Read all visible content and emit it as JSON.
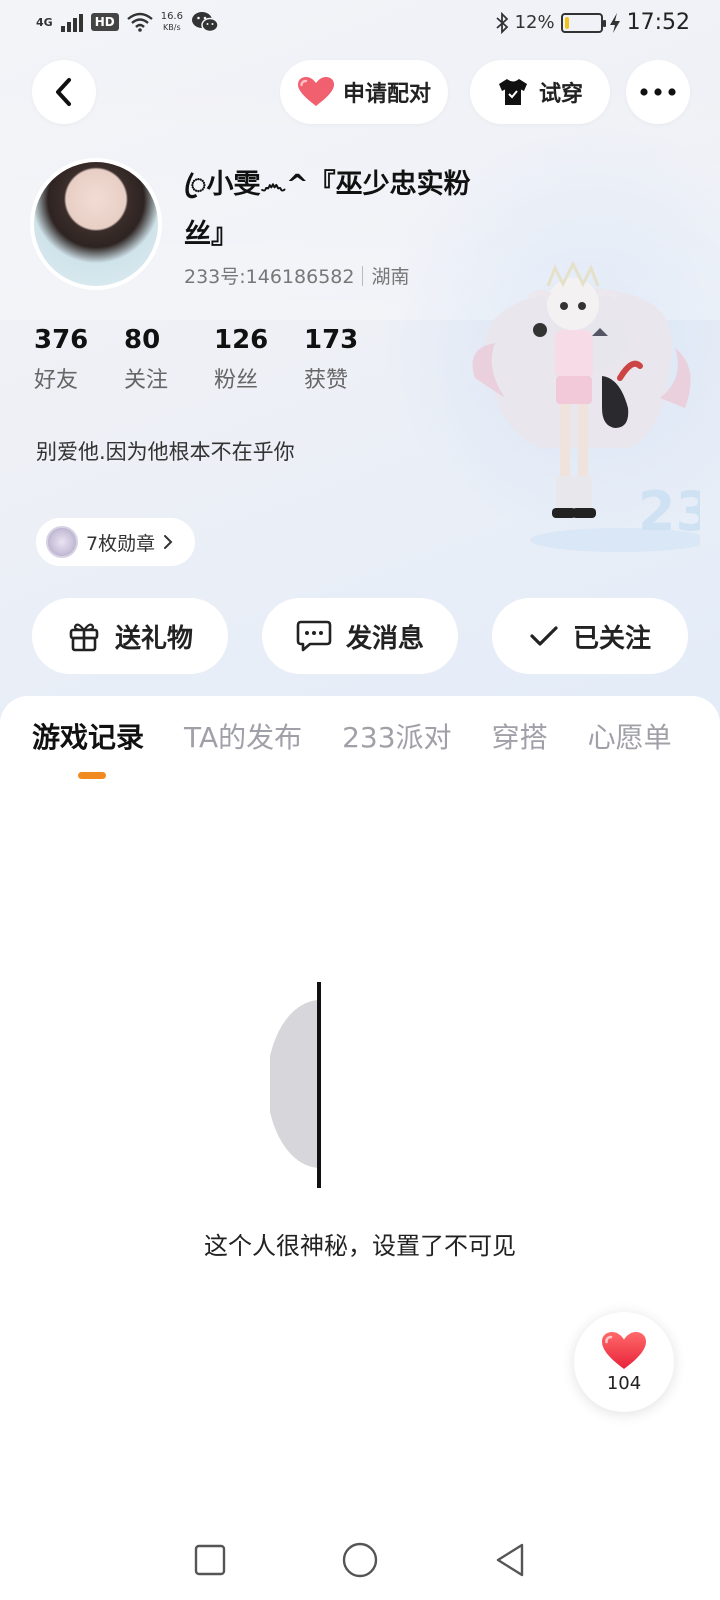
{
  "status_bar": {
    "network": "4G",
    "hd_label": "HD",
    "speed_value": "16.6",
    "speed_unit": "KB/s",
    "battery_percent": "12%",
    "battery_level": 0.12,
    "time": "17:52"
  },
  "header": {
    "pair_label": "申请配对",
    "try_label": "试穿"
  },
  "profile": {
    "name": "ꦿ小雯෴^『巫少忠实粉丝』",
    "id_text": "233号:146186582",
    "region": "湖南",
    "bio": "别爱他.因为他根本不在乎你",
    "medal_label": "7枚勋章",
    "stats": [
      {
        "value": "376",
        "label": "好友"
      },
      {
        "value": "80",
        "label": "关注"
      },
      {
        "value": "126",
        "label": "粉丝"
      },
      {
        "value": "173",
        "label": "获赞"
      }
    ]
  },
  "actions": {
    "gift_label": "送礼物",
    "message_label": "发消息",
    "follow_label": "已关注"
  },
  "tabs": [
    {
      "label": "游戏记录",
      "active": true
    },
    {
      "label": "TA的发布",
      "active": false
    },
    {
      "label": "233派对",
      "active": false
    },
    {
      "label": "穿搭",
      "active": false
    },
    {
      "label": "心愿单",
      "active": false
    }
  ],
  "content": {
    "empty_message": "这个人很神秘，设置了不可见"
  },
  "like": {
    "count": "104"
  },
  "colors": {
    "accent_orange": "#f28a22",
    "heart_red": "#f0404a",
    "battery_yellow": "#f1c21b"
  }
}
